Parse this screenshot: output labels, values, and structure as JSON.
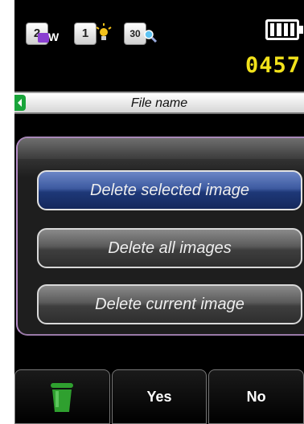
{
  "status": {
    "icon_size": "2",
    "icon_size_sub": "W",
    "icon_flash": "1",
    "icon_zoom": "30",
    "battery_level": 1.0,
    "counter": "0457"
  },
  "file": {
    "label": "File name"
  },
  "menu": {
    "items": [
      {
        "label": "Delete selected image",
        "selected": true
      },
      {
        "label": "Delete all images",
        "selected": false
      },
      {
        "label": "Delete current image",
        "selected": false
      }
    ]
  },
  "softkeys": {
    "yes": "Yes",
    "no": "No"
  },
  "colors": {
    "counter": "#f2e21b",
    "selected": "#2a4a96",
    "trash": "#2fa02f"
  }
}
